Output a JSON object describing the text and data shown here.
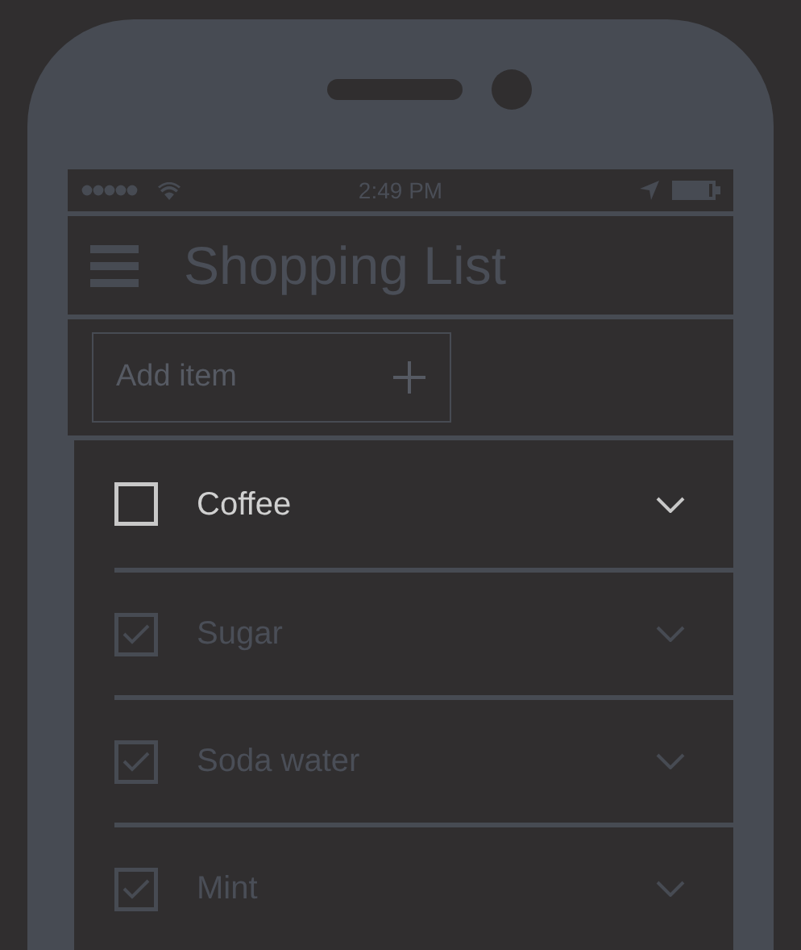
{
  "status_bar": {
    "time": "2:49 PM"
  },
  "header": {
    "title": "Shopping List"
  },
  "add_field": {
    "placeholder": "Add item"
  },
  "items": [
    {
      "label": "Coffee",
      "checked": false
    },
    {
      "label": "Sugar",
      "checked": true
    },
    {
      "label": "Soda water",
      "checked": true
    },
    {
      "label": "Mint",
      "checked": true
    }
  ]
}
